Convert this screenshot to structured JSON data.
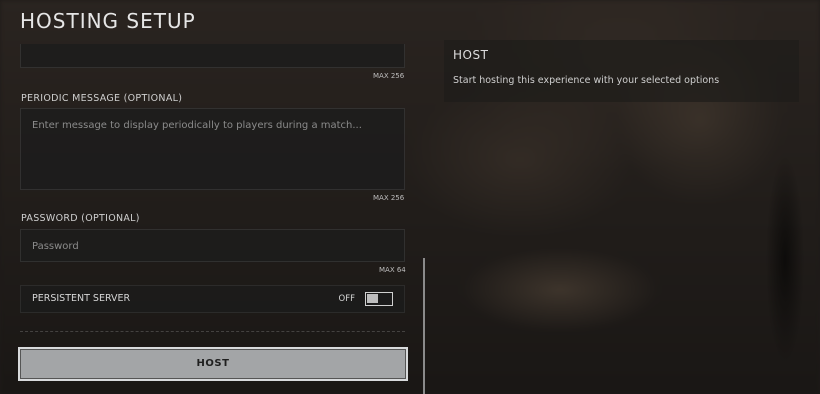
{
  "page": {
    "title": "HOSTING SETUP"
  },
  "form": {
    "top_field": {
      "max": "MAX 256"
    },
    "periodic_message": {
      "label": "PERIODIC MESSAGE (OPTIONAL)",
      "placeholder": "Enter message to display periodically to players during a match...",
      "max": "MAX 256"
    },
    "password": {
      "label": "PASSWORD (OPTIONAL)",
      "placeholder": "Password",
      "max": "MAX 64"
    },
    "persistent_server": {
      "label": "PERSISTENT SERVER",
      "state": "OFF"
    },
    "host_button": "HOST"
  },
  "info_panel": {
    "title": "HOST",
    "description": "Start hosting this experience with your selected options"
  }
}
